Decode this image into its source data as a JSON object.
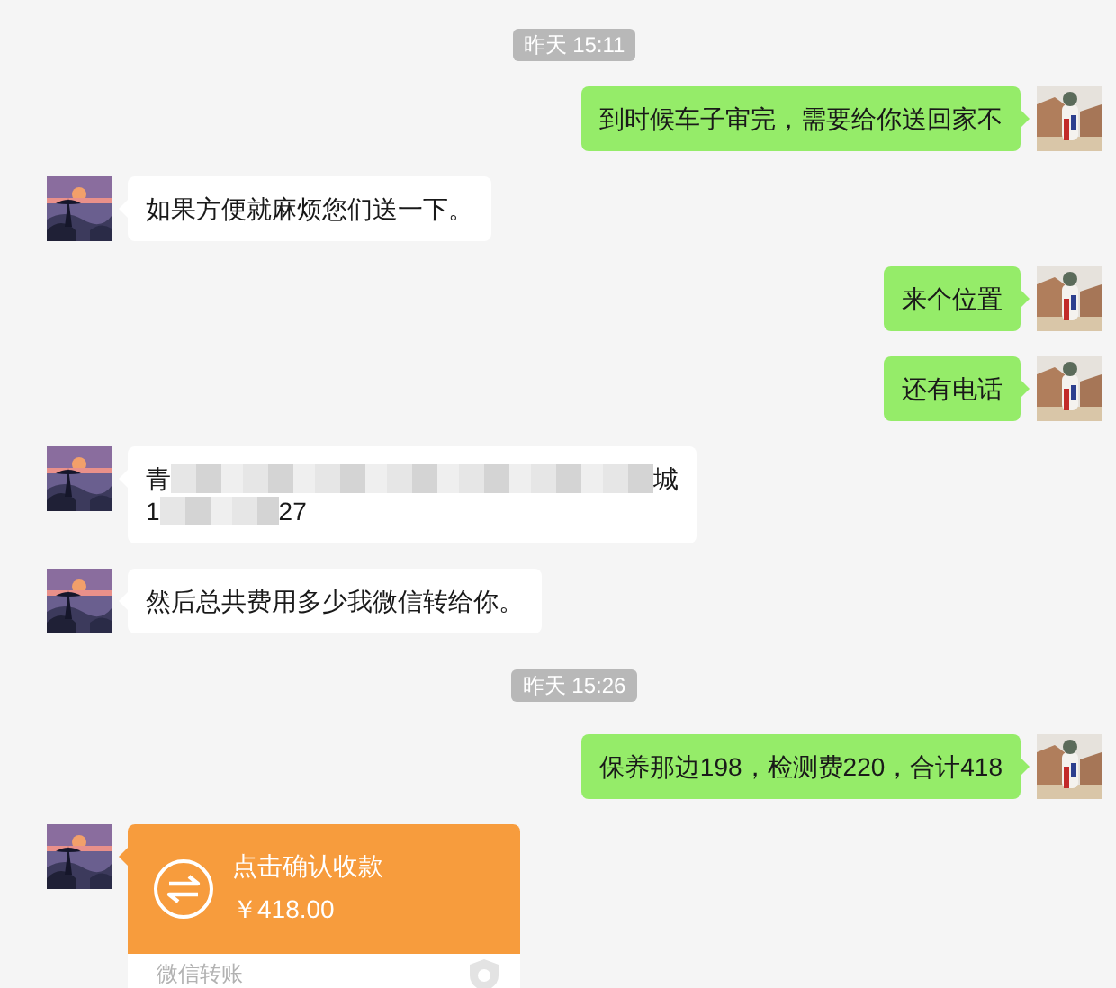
{
  "messages": [
    {
      "kind": "time",
      "text": "昨天 15:11"
    },
    {
      "kind": "text",
      "outgoing": true,
      "text": "到时候车子审完，需要给你送回家不"
    },
    {
      "kind": "text",
      "outgoing": false,
      "text": "如果方便就麻烦您们送一下。"
    },
    {
      "kind": "text",
      "outgoing": true,
      "text": "来个位置"
    },
    {
      "kind": "text",
      "outgoing": true,
      "text": "还有电话"
    },
    {
      "kind": "redacted",
      "outgoing": false,
      "lines": [
        [
          {
            "kind": "text",
            "text": "青"
          },
          {
            "kind": "blur"
          },
          {
            "kind": "text",
            "text": "城"
          }
        ],
        [
          {
            "kind": "text",
            "text": "1"
          },
          {
            "kind": "blur"
          },
          {
            "kind": "text",
            "text": "27"
          }
        ]
      ]
    },
    {
      "kind": "text",
      "outgoing": false,
      "text": "然后总共费用多少我微信转给你。"
    },
    {
      "kind": "time",
      "text": "昨天 15:26"
    },
    {
      "kind": "text",
      "outgoing": true,
      "text": "保养那边198，检测费220，合计418"
    },
    {
      "kind": "transfer",
      "outgoing": false,
      "title": "点击确认收款",
      "amount": "￥418.00",
      "footer": "微信转账"
    }
  ]
}
